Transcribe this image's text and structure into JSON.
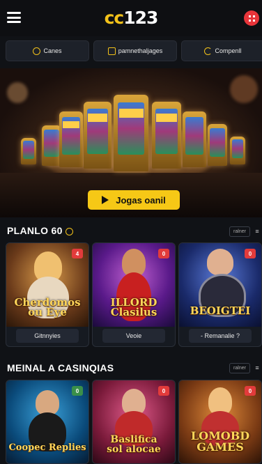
{
  "header": {
    "logo_part1": "cc",
    "logo_part2": "123"
  },
  "tabs": [
    {
      "label": "Canes"
    },
    {
      "label": "pamnethaljages"
    },
    {
      "label": "Compenll"
    }
  ],
  "hero": {
    "cta_label": "Jogas oanil"
  },
  "section1": {
    "title": "PLANLO 60",
    "more_label": "ralner",
    "cards": [
      {
        "title": "Cherdomos\nou Eye",
        "label": "Gitnnyies",
        "badge": "4"
      },
      {
        "title": "ILLORD\nClasilus",
        "label": "Veoie",
        "badge": "0"
      },
      {
        "title": "BEOIGTEI",
        "label": "- Remanalie ?",
        "badge": "0"
      }
    ]
  },
  "section2": {
    "title": "MEINAL A CASINQIAS",
    "more_label": "ralner",
    "cards": [
      {
        "title": "Coopec Replies",
        "badge": "0"
      },
      {
        "title": "Baslifica\nsol alocae",
        "badge": "0"
      },
      {
        "title": "LOMOBD\nGAMES",
        "badge": "0"
      }
    ]
  },
  "colors": {
    "accent": "#f6c816",
    "badge_red": "#e23b3b",
    "badge_green": "#3a8f4a",
    "background": "#101216"
  },
  "icons": [
    "hamburger-icon",
    "user-menu-icon",
    "coin-icon",
    "play-icon",
    "grid-icon"
  ]
}
